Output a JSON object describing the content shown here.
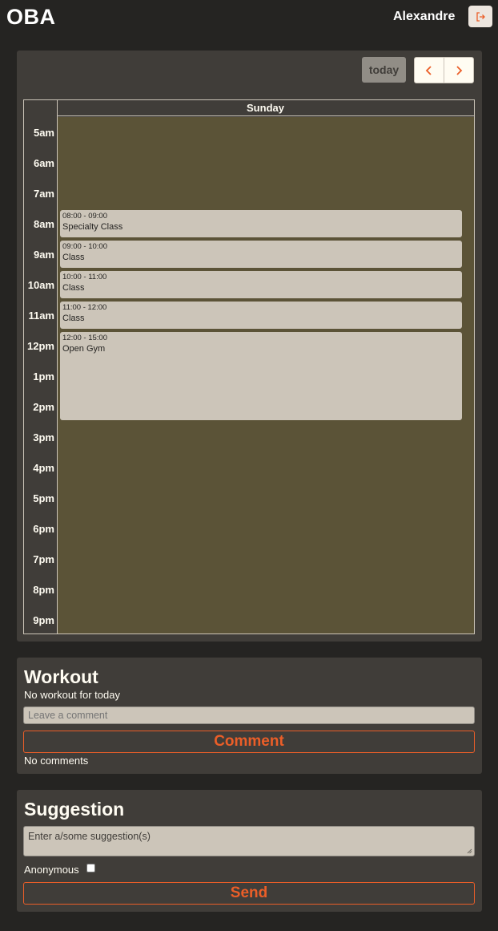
{
  "app": {
    "brand": "OBA",
    "username": "Alexandre"
  },
  "toolbar": {
    "today_label": "today",
    "prev_icon": "chevron-left-icon",
    "next_icon": "chevron-right-icon"
  },
  "calendar": {
    "day_header": "Sunday",
    "hours": [
      "5am",
      "6am",
      "7am",
      "8am",
      "9am",
      "10am",
      "11am",
      "12pm",
      "1pm",
      "2pm",
      "3pm",
      "4pm",
      "5pm",
      "6pm",
      "7pm",
      "8pm",
      "9pm"
    ],
    "events": [
      {
        "time": "08:00 - 09:00",
        "title": "Specialty Class"
      },
      {
        "time": "09:00 - 10:00",
        "title": "Class"
      },
      {
        "time": "10:00 - 11:00",
        "title": "Class"
      },
      {
        "time": "11:00 - 12:00",
        "title": "Class"
      },
      {
        "time": "12:00 - 15:00",
        "title": "Open Gym"
      }
    ]
  },
  "workout": {
    "title": "Workout",
    "status": "No workout for today",
    "comment_placeholder": "Leave a comment",
    "comment_button": "Comment",
    "comments_status": "No comments"
  },
  "suggestion": {
    "title": "Suggestion",
    "placeholder": "Enter a/some suggestion(s)",
    "anonymous_label": "Anonymous",
    "anonymous_checked": false,
    "send_button": "Send"
  },
  "colors": {
    "background": "#252422",
    "card": "#403d39",
    "day_column": "#5b5337",
    "event": "#ccc5b9",
    "accent": "#eb5e28",
    "text": "#fffcf2"
  }
}
